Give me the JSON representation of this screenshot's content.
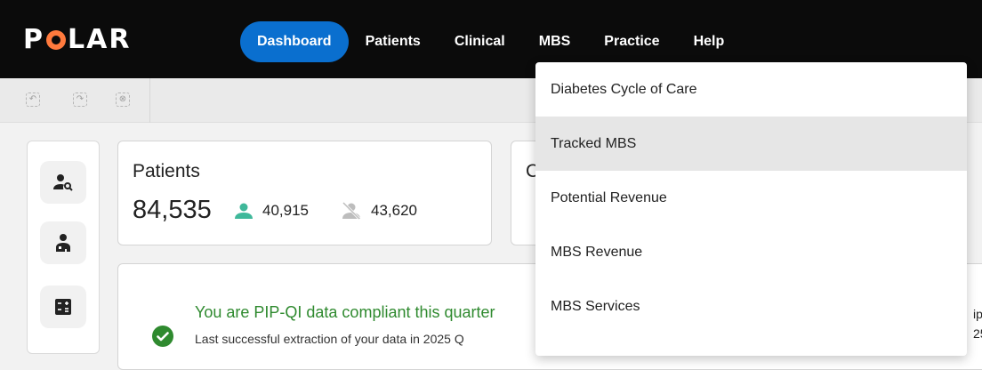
{
  "app": {
    "logo_text_left": "P",
    "logo_text_right": "LAR"
  },
  "nav": {
    "items": [
      {
        "label": "Dashboard",
        "active": true
      },
      {
        "label": "Patients",
        "active": false
      },
      {
        "label": "Clinical",
        "active": false
      },
      {
        "label": "MBS",
        "active": false
      },
      {
        "label": "Practice",
        "active": false
      },
      {
        "label": "Help",
        "active": false
      }
    ]
  },
  "mbs_menu": {
    "items": [
      {
        "label": "Diabetes Cycle of Care"
      },
      {
        "label": "Tracked MBS"
      },
      {
        "label": "Potential Revenue"
      },
      {
        "label": "MBS Revenue"
      },
      {
        "label": "MBS Services"
      }
    ],
    "hovered_index": 1
  },
  "patients_card": {
    "title": "Patients",
    "total": "84,535",
    "active_count": "40,915",
    "inactive_count": "43,620"
  },
  "second_card": {
    "title_peek": "C"
  },
  "compliance": {
    "heading": "You are PIP-QI data compliant this quarter",
    "subtext": "Last successful extraction of your data in 2025 Q",
    "edge_line1": "ip",
    "edge_line2": "25"
  },
  "colors": {
    "nav_bg": "#0b0b0b",
    "accent": "#0a6fcf",
    "success": "#2f8a2f",
    "active_patients_icon": "#3fb89a",
    "logo_orange": "#ff7a3d"
  }
}
